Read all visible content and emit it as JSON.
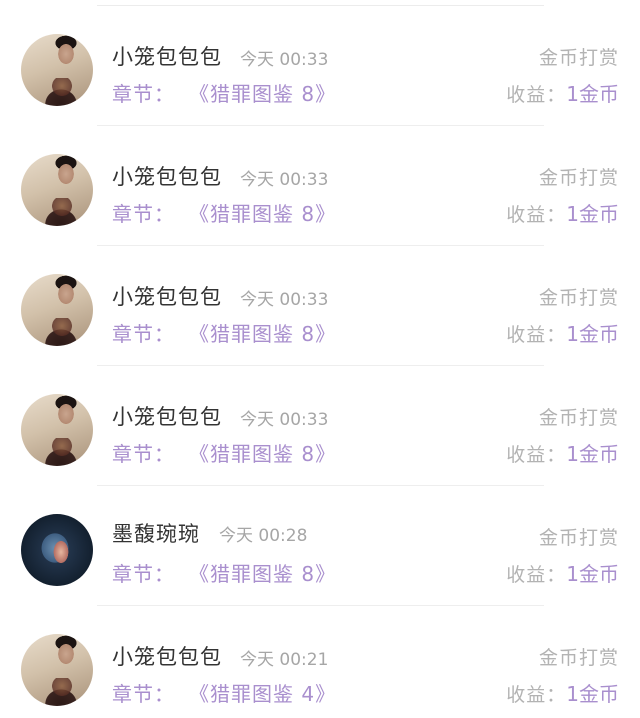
{
  "colors": {
    "accent": "#a98fce",
    "muted": "#b3b3b3",
    "name": "#333333"
  },
  "rewards": [
    {
      "user": "小笼包包包",
      "time": "今天 00:33",
      "type": "金币打赏",
      "chapter_label": "章节：",
      "chapter": "《猎罪图鉴 8》",
      "earn_label": "收益：",
      "earn_value": "1金币",
      "avatar": "man-portrait"
    },
    {
      "user": "小笼包包包",
      "time": "今天 00:33",
      "type": "金币打赏",
      "chapter_label": "章节：",
      "chapter": "《猎罪图鉴 8》",
      "earn_label": "收益：",
      "earn_value": "1金币",
      "avatar": "man-portrait"
    },
    {
      "user": "小笼包包包",
      "time": "今天 00:33",
      "type": "金币打赏",
      "chapter_label": "章节：",
      "chapter": "《猎罪图鉴 8》",
      "earn_label": "收益：",
      "earn_value": "1金币",
      "avatar": "man-portrait"
    },
    {
      "user": "小笼包包包",
      "time": "今天 00:33",
      "type": "金币打赏",
      "chapter_label": "章节：",
      "chapter": "《猎罪图鉴 8》",
      "earn_label": "收益：",
      "earn_value": "1金币",
      "avatar": "man-portrait"
    },
    {
      "user": "墨馥琬琬",
      "time": "今天 00:28",
      "type": "金币打赏",
      "chapter_label": "章节：",
      "chapter": "《猎罪图鉴 8》",
      "earn_label": "收益：",
      "earn_value": "1金币",
      "avatar": "fantasy-art"
    },
    {
      "user": "小笼包包包",
      "time": "今天 00:21",
      "type": "金币打赏",
      "chapter_label": "章节：",
      "chapter": "《猎罪图鉴 4》",
      "earn_label": "收益：",
      "earn_value": "1金币",
      "avatar": "man-portrait"
    }
  ]
}
